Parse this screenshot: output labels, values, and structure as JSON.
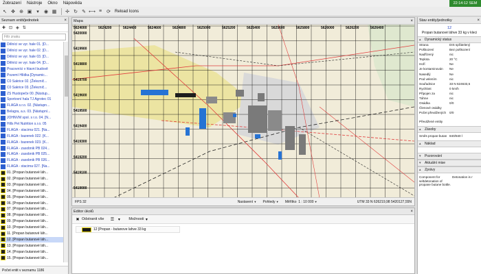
{
  "menu": {
    "items": [
      "Zobrazení",
      "Nástroje",
      "Okno",
      "Nápověda"
    ],
    "clock": "22:14:12 SEM"
  },
  "toolbar": {
    "reload_label": "Reload Icons"
  },
  "left_panel": {
    "title": "Seznam entit/jednotek",
    "filter_placeholder": "Filtr znaku",
    "entities": [
      {
        "label": "Dělníci ve vyr. hale 01. [D...",
        "kind": "blue"
      },
      {
        "label": "Dělníci ve vyr. hale 02. [D...",
        "kind": "blue"
      },
      {
        "label": "Dělníci ve vyr. hale 03. [D...",
        "kind": "blue"
      },
      {
        "label": "Dělníci ve vyr. hale 04. [D...",
        "kind": "blue"
      },
      {
        "label": "Pracovníci v hlavní budově",
        "kind": "blue"
      },
      {
        "label": "Pozemí Hlídka [Dynamic...",
        "kind": "blue"
      },
      {
        "label": "C0 Sakrice 02. [Železnič...",
        "kind": "blue"
      },
      {
        "label": "C0 Sakrice 03. [Železnič...",
        "kind": "blue"
      },
      {
        "label": "ZS Hustopeče 00. [Nástup...",
        "kind": "blue"
      },
      {
        "label": "Sportovní hala TJ Agrotec 01",
        "kind": "blue"
      },
      {
        "label": "FLAGA s.r.o. 02. [Nástupn...",
        "kind": "blue"
      },
      {
        "label": "Belagra, a.s. 03. [Nástupní...",
        "kind": "blue"
      },
      {
        "label": "JOHNVM spol. s r.o. 04. [N...",
        "kind": "blue"
      },
      {
        "label": "Hills Pet Nutrition s.r.o. 05",
        "kind": "blue"
      },
      {
        "label": "FLAGA - stacirna 021. [Na...",
        "kind": "blue"
      },
      {
        "label": "FLAGA - bazenek 022. [K...",
        "kind": "blue"
      },
      {
        "label": "FLAGA - bazenek 023. [K...",
        "kind": "blue"
      },
      {
        "label": "FLAGA - zasobnik PB 024...",
        "kind": "blue"
      },
      {
        "label": "FLAGA - zasobnik PB 025...",
        "kind": "blue"
      },
      {
        "label": "FLAGA - zasobnik PB 026...",
        "kind": "blue"
      },
      {
        "label": "FLAGA - stacirna 027. [Na...",
        "kind": "blue"
      },
      {
        "label": "01. [Propan butanové láh...",
        "kind": "yellow"
      },
      {
        "label": "02. [Propan butanové láh...",
        "kind": "yellow"
      },
      {
        "label": "03. [Propan butanové láh...",
        "kind": "yellow"
      },
      {
        "label": "04. [Propan butanové láh...",
        "kind": "yellow"
      },
      {
        "label": "05. [Propan butanové láh...",
        "kind": "yellow"
      },
      {
        "label": "06. [Propan butanové láh...",
        "kind": "yellow"
      },
      {
        "label": "07. [Propan butanové láh...",
        "kind": "yellow"
      },
      {
        "label": "08. [Propan butanové láh...",
        "kind": "yellow"
      },
      {
        "label": "09. [Propan butanové láh...",
        "kind": "yellow"
      },
      {
        "label": "10. [Propan butanové láh...",
        "kind": "yellow"
      },
      {
        "label": "11. [Propan butanové láh...",
        "kind": "yellow"
      },
      {
        "label": "12. [Propan butanové láh...",
        "kind": "yellow",
        "selected": true
      },
      {
        "label": "13. [Propan butanové láh...",
        "kind": "yellow"
      },
      {
        "label": "14. [Propan butanové láh...",
        "kind": "yellow"
      },
      {
        "label": "15. [Propan butanové láh...",
        "kind": "yellow"
      }
    ],
    "footer": "Počet entit v seznamu 1186"
  },
  "map_panel": {
    "title": "Mapa",
    "x_labels": [
      "5624000",
      "5624200",
      "5624400",
      "5624600",
      "5624800",
      "5625000",
      "5625200",
      "5625400",
      "5625600",
      "5625800",
      "5626000",
      "5626200",
      "5626400"
    ],
    "y_labels": [
      "5420000",
      "5419900",
      "5419800",
      "5419700",
      "5419600",
      "5419500",
      "5419400",
      "5419300",
      "5419200",
      "5419100",
      "5419000"
    ],
    "status": {
      "fps": "FPS 32",
      "settings": "Nastavení",
      "views": "Pohledy",
      "scale_label": "Měřítko",
      "scale": "1 : 10 000",
      "utm": "UTM  33 N 626219,98 5420127,55N"
    }
  },
  "editor": {
    "title": "Editor úkolů",
    "remove_all": "Odstranit vše",
    "options": "Možnosti",
    "order": "12 [Propan - butanove lahve 33 kg"
  },
  "right_panel": {
    "title": "Stav entity/jednotky",
    "entity_number": "12",
    "entity_name": "Propan butanové láhve 33 kg v kleci",
    "sections": {
      "dynamic": "Dynamický status",
      "stocks": "Zásoby",
      "cargo": "Náklad",
      "observations": "Pozorování",
      "missions": "Aktuální mise",
      "reports": "Zprávy"
    },
    "properties": [
      {
        "key": "Strana",
        "value": "DIS spřátelený"
      },
      {
        "key": "Poškození",
        "value": "Bez poškození"
      },
      {
        "key": "Nadřízený",
        "value": "nic"
      },
      {
        "key": "Teplota",
        "value": "20 °C"
      },
      {
        "key": "Hoří",
        "value": "Ne"
      },
      {
        "key": "Je kontaminován",
        "value": "Ne"
      },
      {
        "key": "Nasedlý",
        "value": "Ne"
      },
      {
        "key": "Pod velením",
        "value": "nic"
      },
      {
        "key": "Souřadnice",
        "value": "33 N 624633,5"
      },
      {
        "key": "Rychlost",
        "value": "0 km/h"
      },
      {
        "key": "Připojen za",
        "value": "nic"
      },
      {
        "key": "Táhne",
        "value": "nic"
      },
      {
        "key": "Osádka",
        "value": "0/0"
      },
      {
        "key": "Členové osádky",
        "value": ""
      },
      {
        "key": "Počet převážených",
        "value": "0/0",
        "tall": true
      },
      {
        "key": "Převážené entity",
        "value": ""
      }
    ],
    "stock": {
      "key": "Směs propan-butan",
      "value": "840/840 l"
    },
    "description": {
      "key": "Component for",
      "value": "Detonation is r",
      "text": "Component for seltdetonation of propane butane bottle."
    }
  },
  "colors": {
    "map_bg": "#f1ecd9",
    "map_field": "#ece4a2",
    "building": "#7a7a7a",
    "asset": "#2673d4",
    "road": "#e03c3c",
    "clock_bg": "#2e8b2e"
  }
}
